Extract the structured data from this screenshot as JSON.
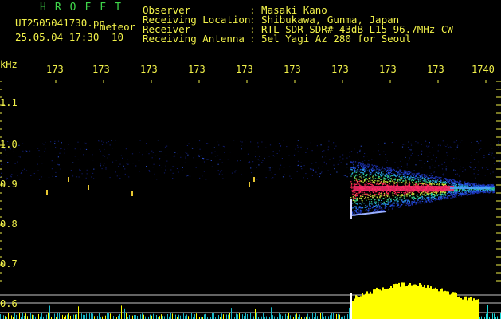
{
  "header": {
    "brand": "HROFFT",
    "filename": "UT2505041730.pn",
    "tag": "meteor",
    "datetime": "25.05.04 17:30",
    "count": "10"
  },
  "info": [
    {
      "label": "Observer",
      "value": ": Masaki Kano"
    },
    {
      "label": "Receiving Location",
      "value": ": Shibukawa, Gunma, Japan"
    },
    {
      "label": "Receiver",
      "value": ": RTL-SDR SDR# 43dB L15 96.7MHz CW"
    },
    {
      "label": "Receiving Antenna",
      "value": ": 5el Yagi Az 280 for Seoul"
    }
  ],
  "axis": {
    "unit": "kHz",
    "x_ticks": [
      "173",
      "173",
      "173",
      "173",
      "173",
      "173",
      "173",
      "173",
      "173",
      "1740"
    ],
    "y_ticks": [
      "1.1",
      "1.0",
      "0.9",
      "0.8",
      "0.7",
      "0.6"
    ]
  },
  "colors": {
    "bg": "#000000",
    "text": "#f2f24a",
    "brand": "#3fd64a",
    "power": "#ffff00",
    "cyan": "#19d9d9"
  }
}
